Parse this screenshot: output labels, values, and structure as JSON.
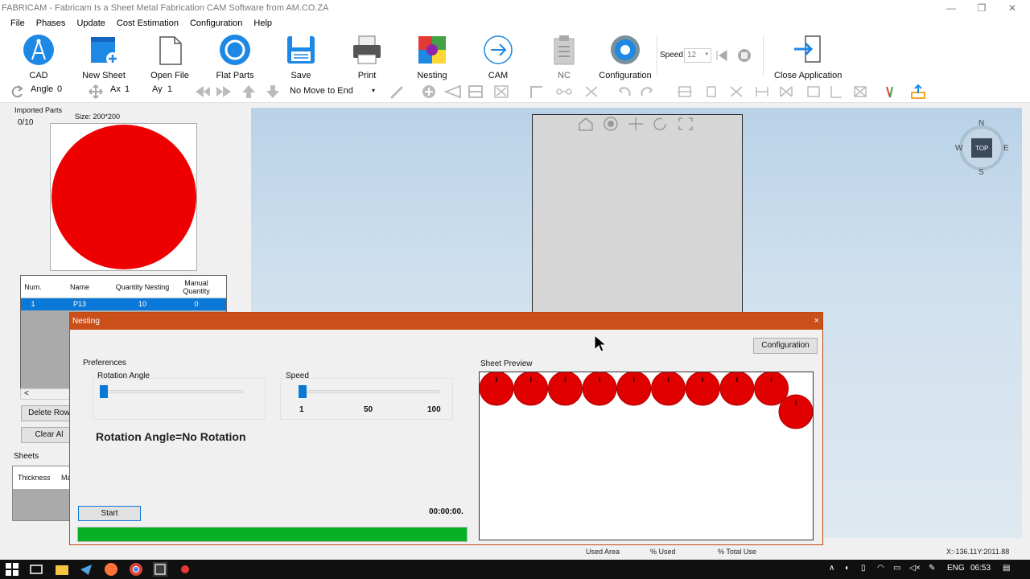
{
  "window": {
    "title": "FABRICAM - Fabricam Is a Sheet Metal Fabrication CAM Software from AM.CO.ZA"
  },
  "menu": [
    "File",
    "Phases",
    "Update",
    "Cost Estimation",
    "Configuration",
    "Help"
  ],
  "ribbon": {
    "buttons": [
      {
        "label": "CAD",
        "icon": "cad-compass-icon"
      },
      {
        "label": "New Sheet",
        "icon": "new-sheet-icon"
      },
      {
        "label": "Open File",
        "icon": "open-file-icon"
      },
      {
        "label": "Flat Parts",
        "icon": "flat-parts-icon"
      },
      {
        "label": "Save",
        "icon": "save-icon"
      },
      {
        "label": "Print",
        "icon": "printer-icon"
      },
      {
        "label": "Nesting",
        "icon": "nesting-icon"
      },
      {
        "label": "CAM",
        "icon": "cam-arrow-icon"
      },
      {
        "label": "NC",
        "icon": "nc-clipboard-icon"
      },
      {
        "label": "Configuration",
        "icon": "configuration-gear-icon"
      },
      {
        "label": "Close Application",
        "icon": "close-application-icon"
      }
    ],
    "speed_label": "Speed",
    "speed_value": "12"
  },
  "toolbar2": {
    "angle_label": "Angle",
    "angle_value": "0",
    "ax_label": "Ax",
    "ax_value": "1",
    "ay_label": "Ay",
    "ay_value": "1",
    "move_option": "No Move to End"
  },
  "left_panel": {
    "imported_label": "Imported Parts",
    "count": "0/10",
    "size": "Size: 200*200",
    "part_color": "#ee0000",
    "table": {
      "headers": [
        "Num.",
        "Name",
        "Quantity Nesting",
        "Manual Quantity"
      ],
      "rows": [
        [
          "1",
          "P13",
          "10",
          "0"
        ]
      ]
    },
    "scroll_arrow": "<",
    "delete_row": "Delete Row",
    "clear_all": "Clear Al",
    "sheets_label": "Sheets",
    "sheets_headers": [
      "Thickness",
      "Ma"
    ]
  },
  "viewport": {
    "compass": {
      "n": "N",
      "s": "S",
      "e": "E",
      "w": "W",
      "top": "TOP"
    },
    "coords": "X:-136.11Y:2011.88",
    "status_cols": [
      "Used Area",
      "% Used",
      "% Total Use"
    ]
  },
  "nesting_dialog": {
    "title": "Nesting",
    "close": "×",
    "config_button": "Configuration",
    "preferences_label": "Preferences",
    "rotation_label": "Rotation Angle",
    "rotation_value": 0,
    "speed_label": "Speed",
    "speed_ticks": [
      "1",
      "50",
      "100"
    ],
    "speed_value": 1,
    "rotation_text": "Rotation Angle=No Rotation",
    "start_button": "Start",
    "timer": "00:00:00.",
    "progress": 1.0,
    "progress_color": "#06b025",
    "sheet_preview_label": "Sheet Preview",
    "nested_part_count": 10,
    "nested_color": "#e00000"
  },
  "taskbar": {
    "lang": "ENG",
    "time": "06:53"
  }
}
